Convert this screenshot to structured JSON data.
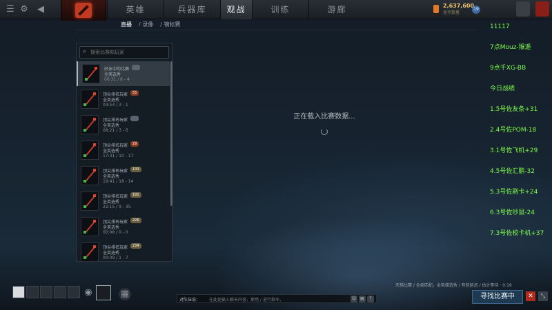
{
  "nav": {
    "tabs": [
      {
        "label": "英雄"
      },
      {
        "label": "兵器库"
      },
      {
        "label": "观战"
      },
      {
        "label": "训练"
      },
      {
        "label": "游廊"
      }
    ],
    "active_tab_index": 2
  },
  "currency": {
    "amount": "2,637,600",
    "label": "金币数量"
  },
  "level_badge": "19",
  "overlay_lines": [
    "11117",
    "7点Mouz-猴遥",
    "9点千XG-BB",
    "今日战绩",
    "1.5号佐友条+31",
    "2.4号佐POM-18",
    "3.1号佐飞机+29",
    "4.5号佐汇鹏-32",
    "5.3号佐刷卡+24",
    "6.3号佐吵鼠-24",
    "7.3号佐校卡机+37"
  ],
  "subnav": {
    "items": [
      "直播",
      "录像",
      "锦标赛"
    ],
    "active_index": 0
  },
  "search": {
    "placeholder": "搜索比赛和玩家"
  },
  "match_list": [
    {
      "title": "好友中的比赛",
      "mode": "全英选秀",
      "time": "06:31 / 6 - 4",
      "badge": "",
      "badge_color": "#5a6470"
    },
    {
      "title": "顶尖排名玩家",
      "mode": "全英选秀",
      "time": "04:54 / 3 - 1",
      "badge": "55",
      "badge_color": "#8a3a20"
    },
    {
      "title": "顶尖排名玩家",
      "mode": "全英选秀",
      "time": "08:21 / 3 - 6",
      "badge": "",
      "badge_color": "#5a6470"
    },
    {
      "title": "顶尖排名玩家",
      "mode": "全英选秀",
      "time": "17:31 / 10 - 17",
      "badge": "29",
      "badge_color": "#8a3a20"
    },
    {
      "title": "顶尖排名玩家",
      "mode": "全英选秀",
      "time": "19:41 / 18 - 14",
      "badge": "133",
      "badge_color": "#6a6040"
    },
    {
      "title": "顶尖排名玩家",
      "mode": "全英选秀",
      "time": "22:15 / 9 - 35",
      "badge": "191",
      "badge_color": "#6a6040"
    },
    {
      "title": "顶尖排名玩家",
      "mode": "全英选秀",
      "time": "00:08 / 0 - 0",
      "badge": "226",
      "badge_color": "#6a6040"
    },
    {
      "title": "顶尖排名玩家",
      "mode": "全英选秀",
      "time": "00:09 / 1 - 7",
      "badge": "234",
      "badge_color": "#6a6040"
    }
  ],
  "loading_text": "正在载入比赛数据...",
  "chat": {
    "label": "对队伍说：",
    "placeholder": "在此处输入聊天内容，使用 / 进行指令。"
  },
  "status_text": "天梯比赛 / 全局匹配，全英雄选秀 / 有些延迟 / 估计等待 · 0:19",
  "find_match_label": "寻找比赛中",
  "colors": {
    "accent": "#c23a22",
    "overlay_text": "#7cfc4a",
    "find_button": "#1e3a52"
  }
}
